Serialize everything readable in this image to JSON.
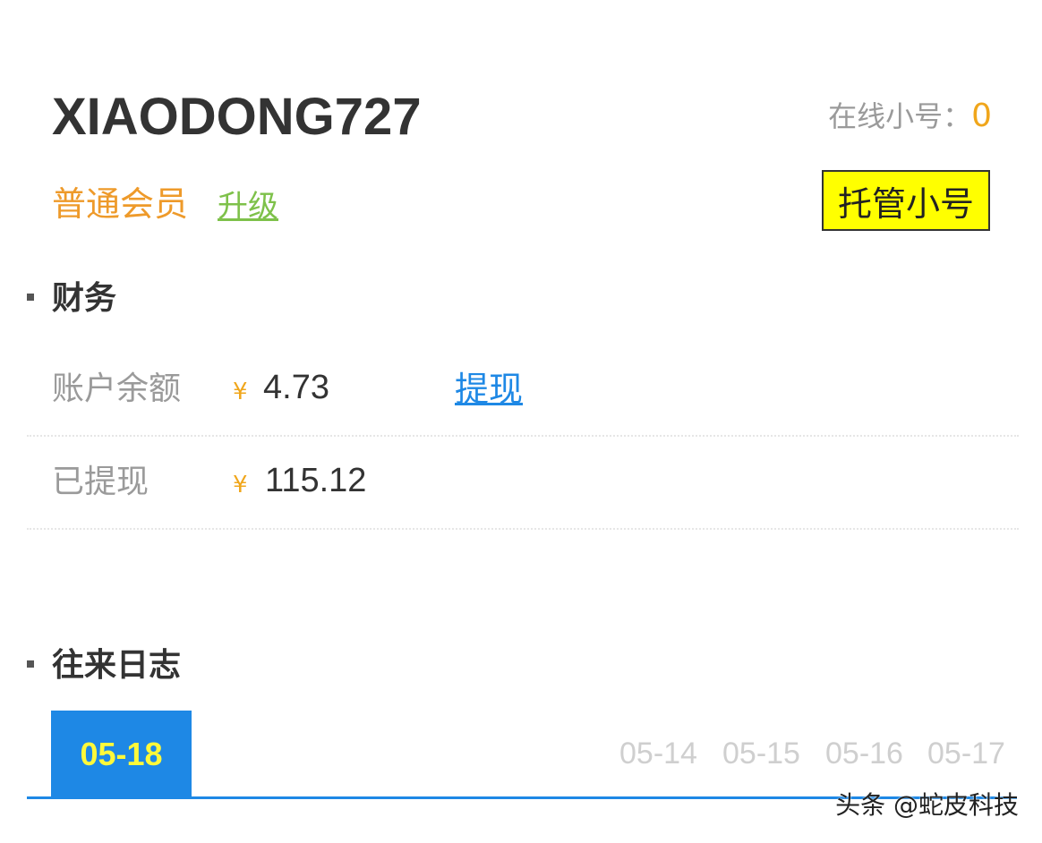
{
  "header": {
    "username": "XIAODONG727",
    "online_label": "在线小号：",
    "online_count": "0",
    "member_level": "普通会员",
    "upgrade_label": "升级",
    "host_button_label": "托管小号"
  },
  "finance": {
    "section_title": "财务",
    "balance_label": "账户余额",
    "currency_symbol": "¥",
    "balance_value": "4.73",
    "withdraw_label": "提现",
    "withdrawn_label": "已提现",
    "withdrawn_value": "115.12"
  },
  "log": {
    "section_title": "往来日志",
    "active_tab": "05-18",
    "tabs": [
      "05-14",
      "05-15",
      "05-16",
      "05-17"
    ]
  },
  "watermark": "头条 @蛇皮科技",
  "colors": {
    "accent_blue": "#1e88e5",
    "orange": "#f0a61b",
    "green": "#7ec14a",
    "yellow": "#ffff00"
  }
}
